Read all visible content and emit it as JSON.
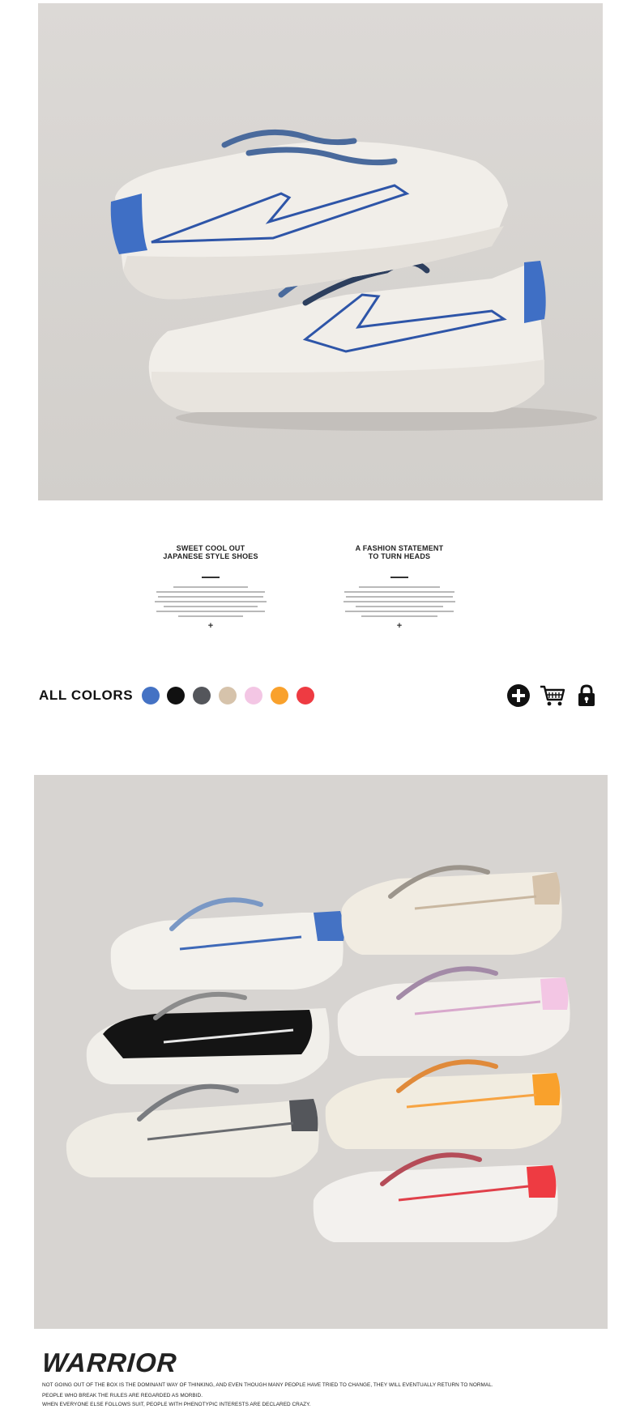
{
  "features": [
    {
      "title_line1": "SWEET COOL OUT",
      "title_line2": "JAPANESE STYLE SHOES"
    },
    {
      "title_line1": "A FASHION STATEMENT",
      "title_line2": "TO TURN HEADS"
    }
  ],
  "colors": {
    "label": "ALL COLORS",
    "swatches": [
      {
        "name": "blue",
        "hex": "#4472c4"
      },
      {
        "name": "black",
        "hex": "#111111"
      },
      {
        "name": "dark-gray",
        "hex": "#54565b"
      },
      {
        "name": "beige",
        "hex": "#d6c3ab"
      },
      {
        "name": "pink",
        "hex": "#f3c6e4"
      },
      {
        "name": "orange",
        "hex": "#f9a12c"
      },
      {
        "name": "red",
        "hex": "#ee3b42"
      }
    ]
  },
  "actions": [
    {
      "name": "add-icon"
    },
    {
      "name": "cart-icon"
    },
    {
      "name": "lock-icon"
    }
  ],
  "brand": {
    "title": "WARRIOR",
    "line1": "NOT GOING OUT OF THE BOX IS THE DOMINANT WAY OF THINKING, AND EVEN THOUGH MANY PEOPLE HAVE TRIED TO CHANGE, THEY WILL EVENTUALLY RETURN TO NORMAL.",
    "line2": "PEOPLE WHO BREAK THE RULES ARE REGARDED AS MORBID.",
    "line3": "WHEN EVERYONE ELSE FOLLOWS SUIT, PEOPLE WITH PHENOTYPIC INTERESTS ARE DECLARED CRAZY."
  },
  "palette": {
    "photo_bg": "#d9d6d3",
    "canvas": "#f1eee9",
    "blue_accent": "#3e69b8"
  }
}
